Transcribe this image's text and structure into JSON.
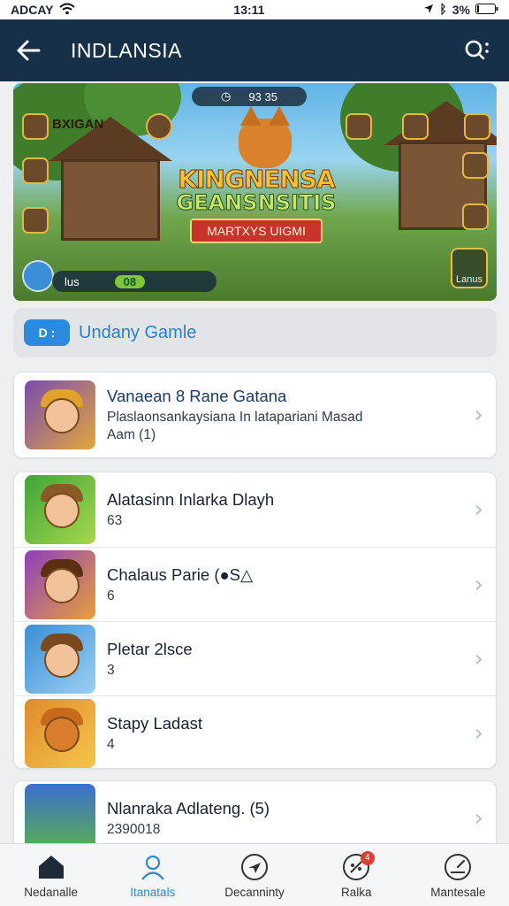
{
  "status_bar": {
    "carrier": "ADCAY",
    "time": "13:11",
    "battery": "3%"
  },
  "header": {
    "title": "INDLANSIA"
  },
  "banner": {
    "logo_line1": "KINGNENSA",
    "logo_line2": "GEANSNSITIS",
    "ribbon": "MARTXYS UIGMI",
    "timer_value": "93 35",
    "bottom_label": "lus",
    "bottom_value": "08",
    "left_chip_label": "BXIGAN",
    "right_button_label": "Lanus"
  },
  "section": {
    "badge": "D :",
    "label": "Undany Gamle"
  },
  "featured": {
    "title": "Vanaean 8  Rane Gatana",
    "subtitle_line1": "Plaslaonsankaysiana In latapariani Masad",
    "subtitle_line2": "Aam (1)"
  },
  "list": [
    {
      "title": "Alatasinn Inlarka Dlayh",
      "meta": "63"
    },
    {
      "title": "Chalaus Parie (●S△",
      "meta": "6"
    },
    {
      "title": "Pletar 2lsce",
      "meta": "3"
    },
    {
      "title": "Stapy Ladast",
      "meta": "4"
    }
  ],
  "last_item": {
    "title": "Nlanraka Adlateng. (5)",
    "meta": "2390018"
  },
  "bottom_nav": [
    {
      "label": "Nedanalle"
    },
    {
      "label": "Itanatals"
    },
    {
      "label": "Decanninty"
    },
    {
      "label": "Ralka",
      "badge": "4"
    },
    {
      "label": "Mantesale"
    }
  ],
  "colors": {
    "header_bg": "#173049",
    "accent": "#2f87d6",
    "badge_red": "#e23c36"
  }
}
